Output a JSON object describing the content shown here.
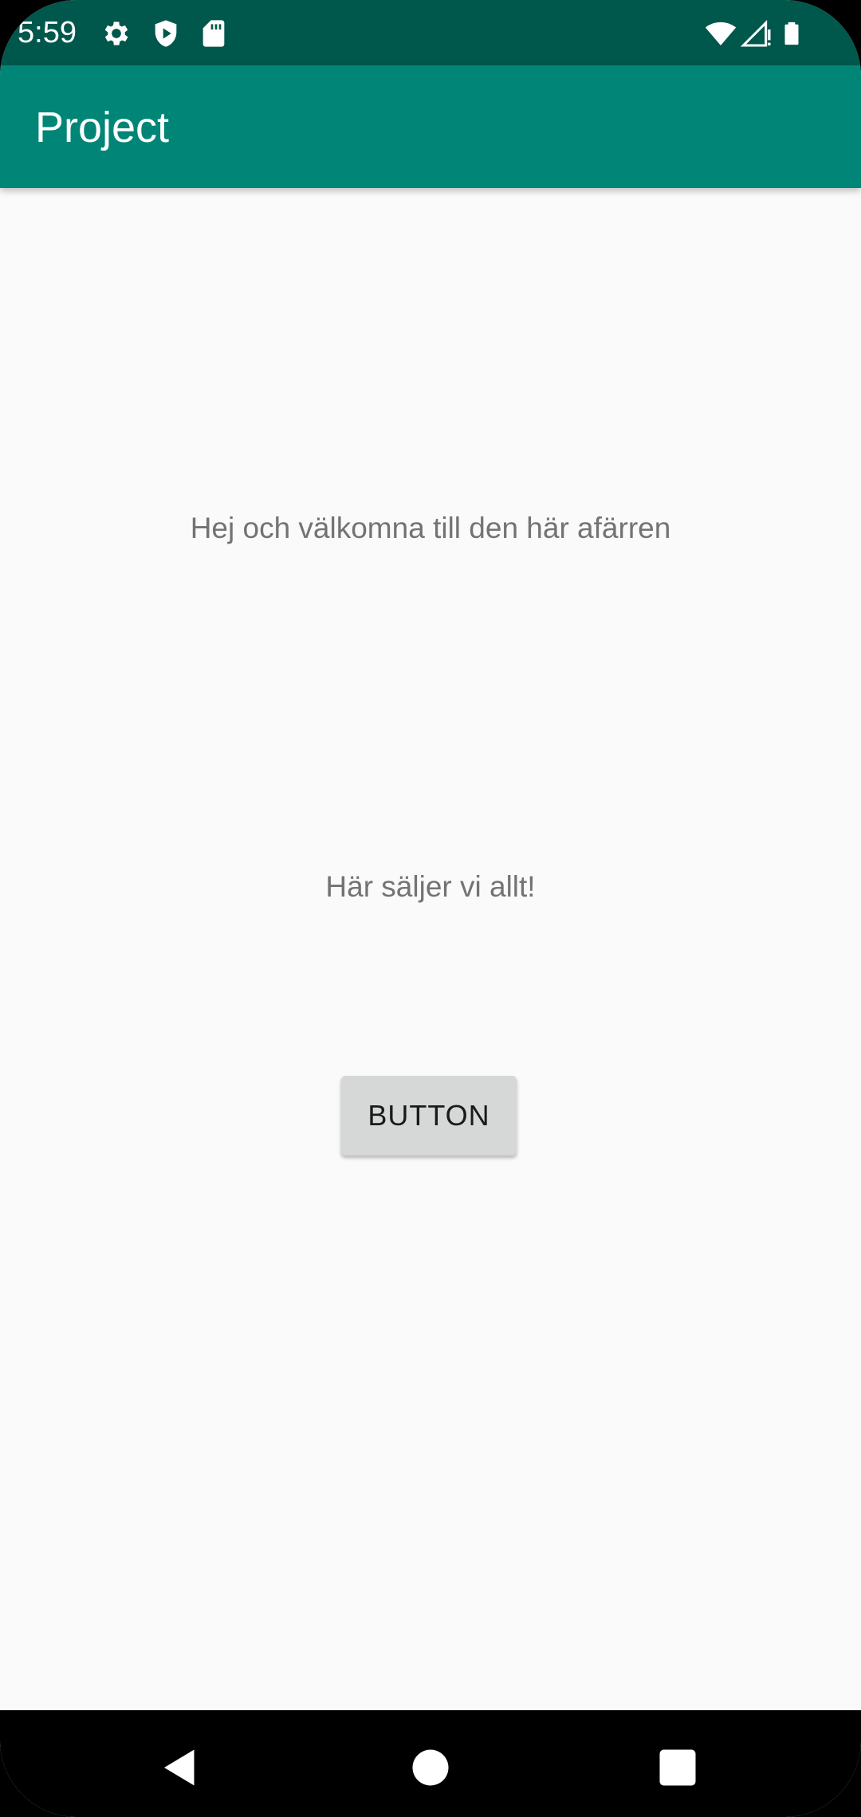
{
  "status_bar": {
    "time": "5:59",
    "left_icons": [
      "gear-icon",
      "shield-play-icon",
      "sd-card-icon"
    ],
    "right_icons": [
      "wifi-icon",
      "cell-signal-icon",
      "battery-icon"
    ],
    "background": "#00574b"
  },
  "app_bar": {
    "title": "Project",
    "background": "#008577"
  },
  "main": {
    "welcome_text": "Hej och välkomna till den här afärren",
    "tagline_text": "Här säljer vi allt!",
    "button_label": "BUTTON"
  },
  "nav_bar": {
    "buttons": [
      "back-icon",
      "home-icon",
      "recents-icon"
    ]
  }
}
